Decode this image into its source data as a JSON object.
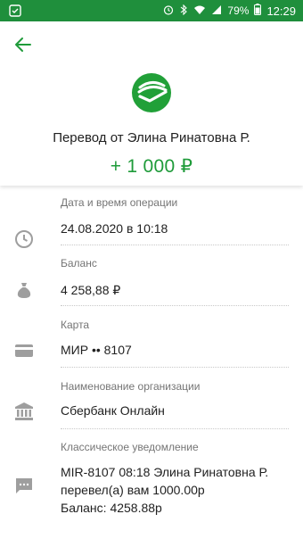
{
  "status_bar": {
    "battery": "79%",
    "time": "12:29"
  },
  "header": {
    "title": "Перевод от Элина Ринатовна Р.",
    "amount": "+ 1 000 ₽"
  },
  "rows": [
    {
      "icon": "clock-icon",
      "label": "Дата и время операции",
      "value": "24.08.2020 в 10:18"
    },
    {
      "icon": "money-bag-icon",
      "label": "Баланс",
      "value": "4 258,88 ₽"
    },
    {
      "icon": "card-icon",
      "label": "Карта",
      "value": "МИР •• 8107"
    },
    {
      "icon": "bank-icon",
      "label": "Наименование организации",
      "value": "Сбербанк Онлайн"
    },
    {
      "icon": "message-icon",
      "label": "Классическое уведомление",
      "value_lines": [
        "MIR-8107 08:18 Элина Ринатовна Р.",
        "перевел(а) вам 1000.00р",
        "Баланс: 4258.88р"
      ]
    }
  ],
  "colors": {
    "accent": "#1f9b3a",
    "status_bar": "#1f8f3c",
    "icon_gray": "#9e9e9e"
  }
}
